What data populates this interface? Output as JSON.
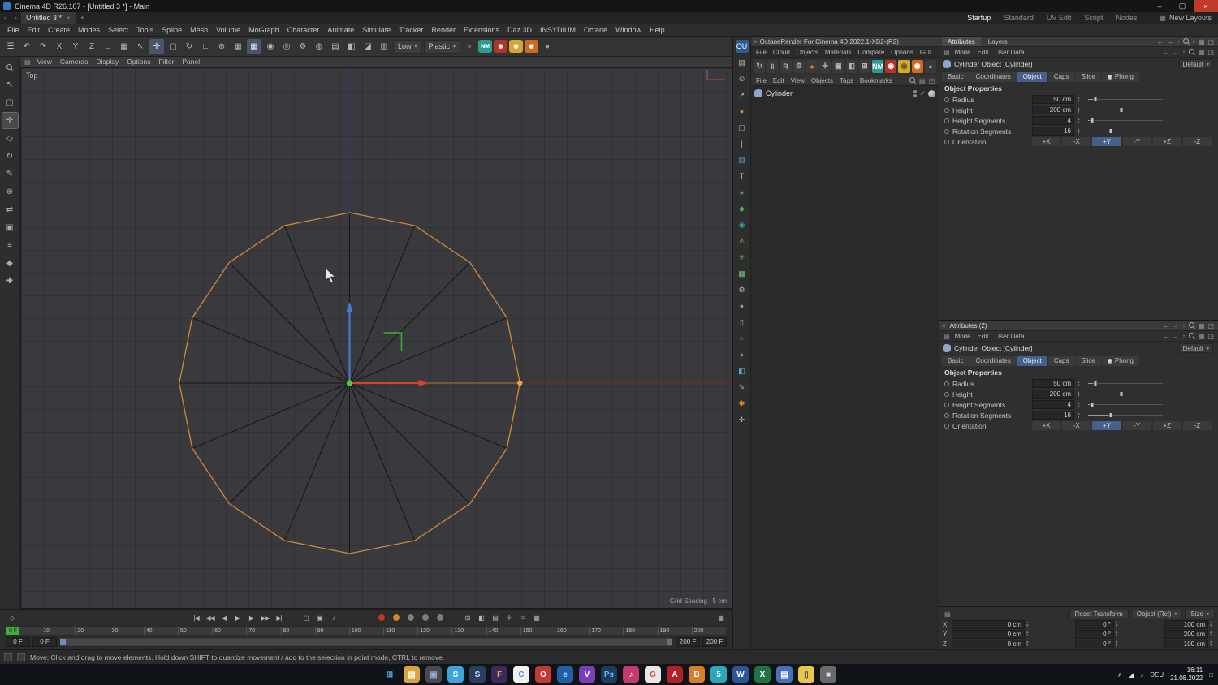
{
  "titlebar": {
    "title": "Cinema 4D R26.107 - [Untitled 3 *] - Main"
  },
  "tabrow": {
    "doc_tab": "Untitled 3 *",
    "layouts": [
      {
        "label": "Startup",
        "name": "layout-startup",
        "active": true
      },
      {
        "label": "Standard",
        "name": "layout-standard"
      },
      {
        "label": "UV Edit",
        "name": "layout-uv-edit"
      },
      {
        "label": "Script",
        "name": "layout-script"
      },
      {
        "label": "Nodes",
        "name": "layout-nodes"
      }
    ],
    "new_layouts": "New Layouts"
  },
  "menubar": {
    "items": [
      {
        "label": "File",
        "name": "menu-file"
      },
      {
        "label": "Edit",
        "name": "menu-edit"
      },
      {
        "label": "Create",
        "name": "menu-create"
      },
      {
        "label": "Modes",
        "name": "menu-modes"
      },
      {
        "label": "Select",
        "name": "menu-select"
      },
      {
        "label": "Tools",
        "name": "menu-tools"
      },
      {
        "label": "Spline",
        "name": "menu-spline"
      },
      {
        "label": "Mesh",
        "name": "menu-mesh"
      },
      {
        "label": "Volume",
        "name": "menu-volume"
      },
      {
        "label": "MoGraph",
        "name": "menu-mograph"
      },
      {
        "label": "Character",
        "name": "menu-character"
      },
      {
        "label": "Animate",
        "name": "menu-animate"
      },
      {
        "label": "Simulate",
        "name": "menu-simulate"
      },
      {
        "label": "Tracker",
        "name": "menu-tracker"
      },
      {
        "label": "Render",
        "name": "menu-render"
      },
      {
        "label": "Extensions",
        "name": "menu-extensions"
      },
      {
        "label": "Daz 3D",
        "name": "menu-daz3d"
      },
      {
        "label": "INSYDIUM",
        "name": "menu-insydium"
      },
      {
        "label": "Octane",
        "name": "menu-octane"
      },
      {
        "label": "Window",
        "name": "menu-window"
      },
      {
        "label": "Help",
        "name": "menu-help"
      }
    ]
  },
  "toolbar": {
    "items": [
      {
        "glyph": "☰",
        "name": "toolbar-menu-icon"
      },
      {
        "glyph": "↶",
        "name": "undo-icon"
      },
      {
        "glyph": "↷",
        "name": "redo-icon"
      },
      {
        "glyph": "X",
        "name": "axis-x-lock-button"
      },
      {
        "glyph": "Y",
        "name": "axis-y-lock-button"
      },
      {
        "glyph": "Z",
        "name": "axis-z-lock-button"
      },
      {
        "glyph": "∟",
        "name": "coordinate-system-icon"
      },
      {
        "glyph": "▦",
        "name": "workplane-icon"
      },
      {
        "glyph": "↖",
        "name": "live-selection-icon"
      },
      {
        "glyph": "✛",
        "name": "move-tool-icon",
        "active": true
      },
      {
        "glyph": "▢",
        "name": "scale-tool-icon"
      },
      {
        "glyph": "↻",
        "name": "rotate-tool-icon"
      },
      {
        "glyph": "∟",
        "name": "last-tool-icon"
      },
      {
        "glyph": "⊕",
        "name": "global-local-toggle-icon"
      },
      {
        "glyph": "▦",
        "name": "snap-settings-icon"
      },
      {
        "glyph": "▦",
        "name": "quantize-icon",
        "active": true
      },
      {
        "glyph": "◉",
        "name": "render-view-icon"
      },
      {
        "glyph": "◎",
        "name": "render-picture-viewer-icon"
      },
      {
        "glyph": "⚙",
        "name": "render-settings-icon"
      },
      {
        "glyph": "◍",
        "name": "interactive-render-icon"
      },
      {
        "glyph": "▤",
        "name": "display-settings-icon"
      },
      {
        "glyph": "◧",
        "name": "display-mode-icon"
      },
      {
        "glyph": "◪",
        "name": "view-panel-icon"
      },
      {
        "glyph": "▥",
        "name": "layout-panel-icon"
      },
      {
        "label": "Low",
        "name": "render-quality-dropdown",
        "cls": "tb-drop"
      },
      {
        "label": "Plastic",
        "name": "material-preview-dropdown",
        "cls": "tb-drop"
      },
      {
        "glyph": "●",
        "name": "material-ball-icon",
        "color": "#666666"
      },
      {
        "label": "NM",
        "name": "nm-plugin-badge",
        "bg": "#2e9a94",
        "cls": "badge"
      },
      {
        "glyph": "◉",
        "name": "red-plugin-badge",
        "bg": "#b23327",
        "cls": "badge"
      },
      {
        "glyph": "◉",
        "name": "yellow-plugin-badge",
        "bg": "#d4a72e",
        "cls": "badge"
      },
      {
        "glyph": "◉",
        "name": "orange-plugin-badge",
        "bg": "#cf6a1e",
        "cls": "badge"
      },
      {
        "glyph": "●",
        "name": "gray-ball-icon",
        "color": "#999999"
      }
    ]
  },
  "left_strip": {
    "items": [
      {
        "glyph": "↖",
        "name": "live-selection-tool-icon"
      },
      {
        "glyph": "▢",
        "name": "rectangle-selection-icon"
      },
      {
        "glyph": "✛",
        "name": "move-tool-icon",
        "active": true
      },
      {
        "glyph": "◇",
        "name": "scale-tool-icon"
      },
      {
        "glyph": "↻",
        "name": "rotate-tool-icon"
      },
      {
        "glyph": "✎",
        "name": "pen-tool-icon"
      },
      {
        "glyph": "⊕",
        "name": "axis-center-icon"
      },
      {
        "glyph": "⇄",
        "name": "swap-icon"
      },
      {
        "glyph": "▣",
        "name": "solo-icon"
      },
      {
        "glyph": "≡",
        "name": "layers-icon"
      },
      {
        "glyph": "◆",
        "name": "points-mode-icon"
      },
      {
        "glyph": "✚",
        "name": "add-primitive-icon"
      }
    ]
  },
  "right_strip": {
    "items": [
      {
        "glyph": "OU",
        "name": "octane-ou-icon",
        "bg": "#2f5a8f",
        "color": "#ffffff"
      },
      {
        "glyph": "▤",
        "name": "panel-icon"
      },
      {
        "glyph": "⊙",
        "name": "target-icon"
      },
      {
        "glyph": "↗",
        "name": "export-icon"
      },
      {
        "glyph": "●",
        "name": "octane-ball-icon",
        "color": "#e8891e"
      },
      {
        "glyph": "▢",
        "name": "square-icon"
      },
      {
        "glyph": "|",
        "name": "divider-icon"
      },
      {
        "glyph": "▤",
        "name": "stack-icon",
        "color": "#5aa0d8"
      },
      {
        "glyph": "T",
        "name": "text-tool-icon"
      },
      {
        "glyph": "●",
        "name": "green-sphere-icon",
        "color": "#4cae4c"
      },
      {
        "glyph": "◆",
        "name": "green-diamond-icon",
        "color": "#4cae4c"
      },
      {
        "glyph": "◉",
        "name": "teal-swirl-icon",
        "color": "#3aa8a0"
      },
      {
        "glyph": "⚠",
        "name": "warning-icon",
        "color": "#e0c030"
      },
      {
        "glyph": "✳",
        "name": "molecule-icon",
        "color": "#4cae4c"
      },
      {
        "glyph": "▦",
        "name": "voxel-icon",
        "color": "#7ac07a"
      },
      {
        "glyph": "⚙",
        "name": "gear-icon"
      },
      {
        "glyph": "●",
        "name": "material-ball-icon",
        "color": "#9a9a9a"
      },
      {
        "glyph": "▯",
        "name": "page-icon"
      },
      {
        "glyph": "≈",
        "name": "curve-icon",
        "color": "#8a7ae0"
      },
      {
        "glyph": "●",
        "name": "blue-dot-icon",
        "color": "#4a90d8"
      },
      {
        "glyph": "◧",
        "name": "cube-icon",
        "color": "#5ab0c8"
      },
      {
        "glyph": "✎",
        "name": "pencil-icon"
      },
      {
        "glyph": "✱",
        "name": "orange-star-icon",
        "color": "#e8891e"
      },
      {
        "glyph": "✛",
        "name": "move-axis-icon"
      }
    ]
  },
  "viewport": {
    "menus": [
      {
        "label": "View",
        "name": "vp-menu-view"
      },
      {
        "label": "Cameras",
        "name": "vp-menu-cameras"
      },
      {
        "label": "Display",
        "name": "vp-menu-display"
      },
      {
        "label": "Options",
        "name": "vp-menu-options"
      },
      {
        "label": "Filter",
        "name": "vp-menu-filter"
      },
      {
        "label": "Panel",
        "name": "vp-menu-panel"
      }
    ],
    "view_label": "Top",
    "grid_spacing": "Grid Spacing : 5 cm"
  },
  "scene": {
    "view": "Top",
    "object": "Cylinder",
    "sides": 16,
    "center": [
      405,
      388
    ],
    "radius": 210,
    "colors": {
      "outline": "#d2883c",
      "edges": "#151515",
      "world_z_line": "#2c3e6e",
      "world_x_line": "#6e2f28",
      "axis_x": "#d8412c",
      "axis_z": "#4a7bd8",
      "origin": "#5ec13c",
      "plane_handle": "#3fae3f",
      "radius_handle": "#e8a44c",
      "radius_handle_line": "#b5742c"
    }
  },
  "octane": {
    "title": "OctaneRender For Cinema 4D 2022.1-XB2-(R2)",
    "menus": [
      {
        "label": "File",
        "name": "octane-menu-file"
      },
      {
        "label": "Cloud",
        "name": "octane-menu-cloud"
      },
      {
        "label": "Objects",
        "name": "octane-menu-objects"
      },
      {
        "label": "Materials",
        "name": "octane-menu-materials"
      },
      {
        "label": "Compare",
        "name": "octane-menu-compare"
      },
      {
        "label": "Options",
        "name": "octane-menu-options"
      },
      {
        "label": "GUI",
        "name": "octane-menu-gui"
      }
    ],
    "toolbar_icons": [
      {
        "glyph": "↻",
        "name": "restart-render-icon"
      },
      {
        "glyph": "‖",
        "name": "pause-render-icon"
      },
      {
        "glyph": "R",
        "name": "reset-render-icon"
      },
      {
        "glyph": "⚙",
        "name": "kernel-settings-icon"
      },
      {
        "glyph": "●",
        "name": "octane-ball-icon",
        "color": "#e8891e"
      },
      {
        "glyph": "✛",
        "name": "pick-focus-icon"
      },
      {
        "glyph": "▣",
        "name": "render-region-icon"
      },
      {
        "glyph": "◧",
        "name": "camera-icon"
      },
      {
        "glyph": "⊞",
        "name": "grid-icon"
      },
      {
        "glyph": "NM",
        "name": "nm-badge",
        "bg": "#2e9a94",
        "color": "#ffffff"
      },
      {
        "glyph": "◉",
        "name": "red-badge",
        "bg": "#b23327",
        "color": "#ffffff"
      },
      {
        "glyph": "◉",
        "name": "yellow-badge",
        "bg": "#d4a72e",
        "color": "#665522"
      },
      {
        "glyph": "◉",
        "name": "orange-badge",
        "bg": "#cf6a1e",
        "color": "#ffffff"
      },
      {
        "glyph": "●",
        "name": "gray-ball-icon",
        "color": "#9a9a9a"
      }
    ],
    "om_menus": [
      {
        "label": "File",
        "name": "om-menu-file"
      },
      {
        "label": "Edit",
        "name": "om-menu-edit"
      },
      {
        "label": "View",
        "name": "om-menu-view"
      },
      {
        "label": "Objects",
        "name": "om-menu-objects"
      },
      {
        "label": "Tags",
        "name": "om-menu-tags"
      },
      {
        "label": "Bookmarks",
        "name": "om-menu-bookmarks"
      }
    ],
    "objects": [
      {
        "name": "Cylinder"
      }
    ]
  },
  "attributes": {
    "panel_tabs": [
      "Attributes",
      "Layers"
    ],
    "panel2_title": "Attributes (2)",
    "mode_menus": [
      {
        "label": "Mode",
        "name": "attr-menu-mode"
      },
      {
        "label": "Edit",
        "name": "attr-menu-edit"
      },
      {
        "label": "User Data",
        "name": "attr-menu-user-data"
      }
    ],
    "object_title": "Cylinder Object [Cylinder]",
    "preset": "Default",
    "tabs": [
      {
        "label": "Basic",
        "name": "tab-basic"
      },
      {
        "label": "Coordinates",
        "name": "tab-coordinates"
      },
      {
        "label": "Object",
        "name": "tab-object",
        "active": true
      },
      {
        "label": "Caps",
        "name": "tab-caps"
      },
      {
        "label": "Slice",
        "name": "tab-slice"
      },
      {
        "label": "Phong",
        "name": "tab-phong",
        "cls": "ptab-phong"
      }
    ],
    "section": "Object Properties",
    "properties": [
      {
        "label": "Radius",
        "value": "50 cm",
        "slider_pct": 10
      },
      {
        "label": "Height",
        "value": "200 cm",
        "slider_pct": 45
      },
      {
        "label": "Height Segments",
        "value": "4",
        "slider_pct": 5
      },
      {
        "label": "Rotation Segments",
        "value": "16",
        "slider_pct": 30
      }
    ],
    "orientation_label": "Orientation",
    "orientation_buttons": [
      {
        "label": "+X",
        "name": "orient-plus-x"
      },
      {
        "label": "-X",
        "name": "orient-minus-x"
      },
      {
        "label": "+Y",
        "name": "orient-plus-y",
        "active": true
      },
      {
        "label": "-Y",
        "name": "orient-minus-y"
      },
      {
        "label": "+Z",
        "name": "orient-plus-z"
      },
      {
        "label": "-Z",
        "name": "orient-minus-z"
      }
    ]
  },
  "coords": {
    "reset": "Reset Transform",
    "mode_dropdown": "Object (Rel)",
    "size_dropdown": "Size",
    "rows": [
      {
        "axis": "X",
        "pos": "0 cm",
        "rot": "0 °",
        "size": "100 cm"
      },
      {
        "axis": "Y",
        "pos": "0 cm",
        "rot": "0 °",
        "size": "200 cm"
      },
      {
        "axis": "Z",
        "pos": "0 cm",
        "rot": "0 °",
        "size": "100 cm"
      }
    ]
  },
  "timeline": {
    "transport": [
      {
        "glyph": "|◀",
        "name": "goto-start-button"
      },
      {
        "glyph": "◀◀",
        "name": "previous-key-button"
      },
      {
        "glyph": "◀",
        "name": "previous-frame-button"
      },
      {
        "glyph": "▶",
        "name": "play-button"
      },
      {
        "glyph": "▶",
        "name": "next-frame-button"
      },
      {
        "glyph": "▶▶",
        "name": "next-key-button"
      },
      {
        "glyph": "▶|",
        "name": "goto-end-button"
      }
    ],
    "toggles": [
      {
        "glyph": "▢",
        "name": "record-keyframe-icon"
      },
      {
        "glyph": "▣",
        "name": "autokey-icon"
      },
      {
        "glyph": "♪",
        "name": "sound-toggle-icon"
      }
    ],
    "record_dots": [
      {
        "name": "record-position-toggle",
        "bg": "#c0392b"
      },
      {
        "name": "record-scale-toggle",
        "bg": "#d6862a"
      },
      {
        "name": "record-rotation-toggle",
        "bg": "#7e7e7e"
      },
      {
        "name": "record-parameter-toggle",
        "bg": "#7e7e7e"
      },
      {
        "name": "record-pla-toggle",
        "bg": "#7e7e7e"
      }
    ],
    "key_icons": [
      {
        "glyph": "⊞",
        "name": "keyframe-selection-icon"
      },
      {
        "glyph": "◧",
        "name": "keyframe-mode-icon"
      },
      {
        "glyph": "▤",
        "name": "timeline-window-icon"
      },
      {
        "glyph": "✛",
        "name": "motion-system-icon"
      },
      {
        "glyph": "≡",
        "name": "fcurve-icon"
      },
      {
        "glyph": "▦",
        "name": "dopesheet-icon"
      }
    ],
    "ticks": [
      "0",
      "10",
      "20",
      "30",
      "40",
      "50",
      "60",
      "70",
      "80",
      "90",
      "100",
      "110",
      "120",
      "130",
      "140",
      "150",
      "160",
      "170",
      "180",
      "190",
      "200"
    ],
    "playhead": "0 F",
    "range_start": "0 F",
    "current_frame": "0 F",
    "range_end": "200 F",
    "max_frame": "200 F"
  },
  "statusbar": {
    "text": "Move: Click and drag to move elements. Hold down SHIFT to quantize movement / add to the selection in point mode, CTRL to remove."
  },
  "taskbar": {
    "icons": [
      {
        "glyph": "⊞",
        "name": "start-button",
        "color": "#5ab4f0"
      },
      {
        "glyph": "▤",
        "name": "file-explorer-icon",
        "bg": "#d8a43c",
        "color": "#ffffff"
      },
      {
        "glyph": "▣",
        "name": "photos-icon",
        "bg": "#4a4a4a",
        "color": "#99aadd"
      },
      {
        "glyph": "S",
        "name": "skype-icon",
        "bg": "#3fa4dc",
        "color": "#ffffff"
      },
      {
        "glyph": "S",
        "name": "steam-icon",
        "bg": "#2a3f5f",
        "color": "#ccddee"
      },
      {
        "glyph": "F",
        "name": "firefox-icon",
        "bg": "#3a2a5f",
        "color": "#ff9a2a"
      },
      {
        "glyph": "C",
        "name": "chrome-icon",
        "bg": "#f1f1f1",
        "color": "#4a90d9"
      },
      {
        "glyph": "O",
        "name": "opera-icon",
        "bg": "#c23b2e",
        "color": "#ffffff"
      },
      {
        "glyph": "e",
        "name": "edge-icon",
        "bg": "#1f5fa8",
        "color": "#aaeeee"
      },
      {
        "glyph": "V",
        "name": "vivaldi-icon",
        "bg": "#7a3fb8",
        "color": "#ffffff"
      },
      {
        "glyph": "Ps",
        "name": "photoshop-icon",
        "bg": "#1e3a5f",
        "color": "#6ab6f0"
      },
      {
        "glyph": "♪",
        "name": "music-app-icon",
        "bg": "#c23b6e",
        "color": "#ffffff"
      },
      {
        "glyph": "G",
        "name": "google-icon",
        "bg": "#e8e8e8",
        "color": "#d24b3a"
      },
      {
        "glyph": "A",
        "name": "adobe-icon",
        "bg": "#b22222",
        "color": "#ffffff"
      },
      {
        "glyph": "B",
        "name": "blender-icon",
        "bg": "#d87d2a",
        "color": "#ffffff"
      },
      {
        "glyph": "5",
        "name": "samsung-flow-icon",
        "bg": "#2aa8b8",
        "color": "#ffffff"
      },
      {
        "glyph": "W",
        "name": "word-icon",
        "bg": "#2b579a",
        "color": "#ffffff"
      },
      {
        "glyph": "X",
        "name": "excel-icon",
        "bg": "#217346",
        "color": "#ffffff"
      },
      {
        "glyph": "▤",
        "name": "onenote-icon",
        "bg": "#4a6fb8",
        "color": "#ffffff"
      },
      {
        "glyph": "▯",
        "name": "notepad-icon",
        "bg": "#e8c84a",
        "color": "#555555"
      },
      {
        "glyph": "■",
        "name": "app-icon",
        "bg": "#6a6a6a",
        "color": "#dddddd"
      }
    ],
    "language": "DEU",
    "time": "16:11",
    "date": "21.08.2022"
  }
}
